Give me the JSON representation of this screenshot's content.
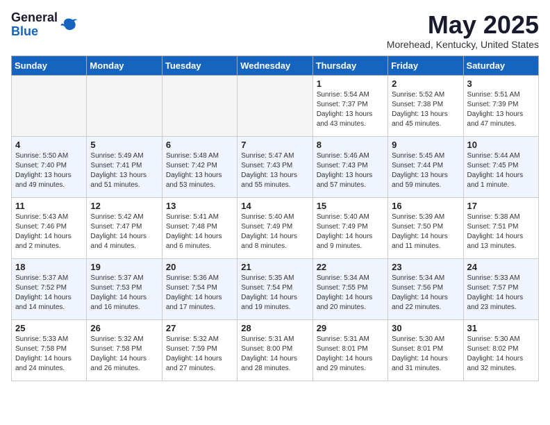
{
  "logo": {
    "general": "General",
    "blue": "Blue"
  },
  "title": "May 2025",
  "location": "Morehead, Kentucky, United States",
  "days_of_week": [
    "Sunday",
    "Monday",
    "Tuesday",
    "Wednesday",
    "Thursday",
    "Friday",
    "Saturday"
  ],
  "weeks": [
    [
      {
        "day": "",
        "empty": true
      },
      {
        "day": "",
        "empty": true
      },
      {
        "day": "",
        "empty": true
      },
      {
        "day": "",
        "empty": true
      },
      {
        "day": "1",
        "sunrise": "5:54 AM",
        "sunset": "7:37 PM",
        "daylight": "13 hours and 43 minutes."
      },
      {
        "day": "2",
        "sunrise": "5:52 AM",
        "sunset": "7:38 PM",
        "daylight": "13 hours and 45 minutes."
      },
      {
        "day": "3",
        "sunrise": "5:51 AM",
        "sunset": "7:39 PM",
        "daylight": "13 hours and 47 minutes."
      }
    ],
    [
      {
        "day": "4",
        "sunrise": "5:50 AM",
        "sunset": "7:40 PM",
        "daylight": "13 hours and 49 minutes."
      },
      {
        "day": "5",
        "sunrise": "5:49 AM",
        "sunset": "7:41 PM",
        "daylight": "13 hours and 51 minutes."
      },
      {
        "day": "6",
        "sunrise": "5:48 AM",
        "sunset": "7:42 PM",
        "daylight": "13 hours and 53 minutes."
      },
      {
        "day": "7",
        "sunrise": "5:47 AM",
        "sunset": "7:43 PM",
        "daylight": "13 hours and 55 minutes."
      },
      {
        "day": "8",
        "sunrise": "5:46 AM",
        "sunset": "7:43 PM",
        "daylight": "13 hours and 57 minutes."
      },
      {
        "day": "9",
        "sunrise": "5:45 AM",
        "sunset": "7:44 PM",
        "daylight": "13 hours and 59 minutes."
      },
      {
        "day": "10",
        "sunrise": "5:44 AM",
        "sunset": "7:45 PM",
        "daylight": "14 hours and 1 minute."
      }
    ],
    [
      {
        "day": "11",
        "sunrise": "5:43 AM",
        "sunset": "7:46 PM",
        "daylight": "14 hours and 2 minutes."
      },
      {
        "day": "12",
        "sunrise": "5:42 AM",
        "sunset": "7:47 PM",
        "daylight": "14 hours and 4 minutes."
      },
      {
        "day": "13",
        "sunrise": "5:41 AM",
        "sunset": "7:48 PM",
        "daylight": "14 hours and 6 minutes."
      },
      {
        "day": "14",
        "sunrise": "5:40 AM",
        "sunset": "7:49 PM",
        "daylight": "14 hours and 8 minutes."
      },
      {
        "day": "15",
        "sunrise": "5:40 AM",
        "sunset": "7:49 PM",
        "daylight": "14 hours and 9 minutes."
      },
      {
        "day": "16",
        "sunrise": "5:39 AM",
        "sunset": "7:50 PM",
        "daylight": "14 hours and 11 minutes."
      },
      {
        "day": "17",
        "sunrise": "5:38 AM",
        "sunset": "7:51 PM",
        "daylight": "14 hours and 13 minutes."
      }
    ],
    [
      {
        "day": "18",
        "sunrise": "5:37 AM",
        "sunset": "7:52 PM",
        "daylight": "14 hours and 14 minutes."
      },
      {
        "day": "19",
        "sunrise": "5:37 AM",
        "sunset": "7:53 PM",
        "daylight": "14 hours and 16 minutes."
      },
      {
        "day": "20",
        "sunrise": "5:36 AM",
        "sunset": "7:54 PM",
        "daylight": "14 hours and 17 minutes."
      },
      {
        "day": "21",
        "sunrise": "5:35 AM",
        "sunset": "7:54 PM",
        "daylight": "14 hours and 19 minutes."
      },
      {
        "day": "22",
        "sunrise": "5:34 AM",
        "sunset": "7:55 PM",
        "daylight": "14 hours and 20 minutes."
      },
      {
        "day": "23",
        "sunrise": "5:34 AM",
        "sunset": "7:56 PM",
        "daylight": "14 hours and 22 minutes."
      },
      {
        "day": "24",
        "sunrise": "5:33 AM",
        "sunset": "7:57 PM",
        "daylight": "14 hours and 23 minutes."
      }
    ],
    [
      {
        "day": "25",
        "sunrise": "5:33 AM",
        "sunset": "7:58 PM",
        "daylight": "14 hours and 24 minutes."
      },
      {
        "day": "26",
        "sunrise": "5:32 AM",
        "sunset": "7:58 PM",
        "daylight": "14 hours and 26 minutes."
      },
      {
        "day": "27",
        "sunrise": "5:32 AM",
        "sunset": "7:59 PM",
        "daylight": "14 hours and 27 minutes."
      },
      {
        "day": "28",
        "sunrise": "5:31 AM",
        "sunset": "8:00 PM",
        "daylight": "14 hours and 28 minutes."
      },
      {
        "day": "29",
        "sunrise": "5:31 AM",
        "sunset": "8:01 PM",
        "daylight": "14 hours and 29 minutes."
      },
      {
        "day": "30",
        "sunrise": "5:30 AM",
        "sunset": "8:01 PM",
        "daylight": "14 hours and 31 minutes."
      },
      {
        "day": "31",
        "sunrise": "5:30 AM",
        "sunset": "8:02 PM",
        "daylight": "14 hours and 32 minutes."
      }
    ]
  ]
}
